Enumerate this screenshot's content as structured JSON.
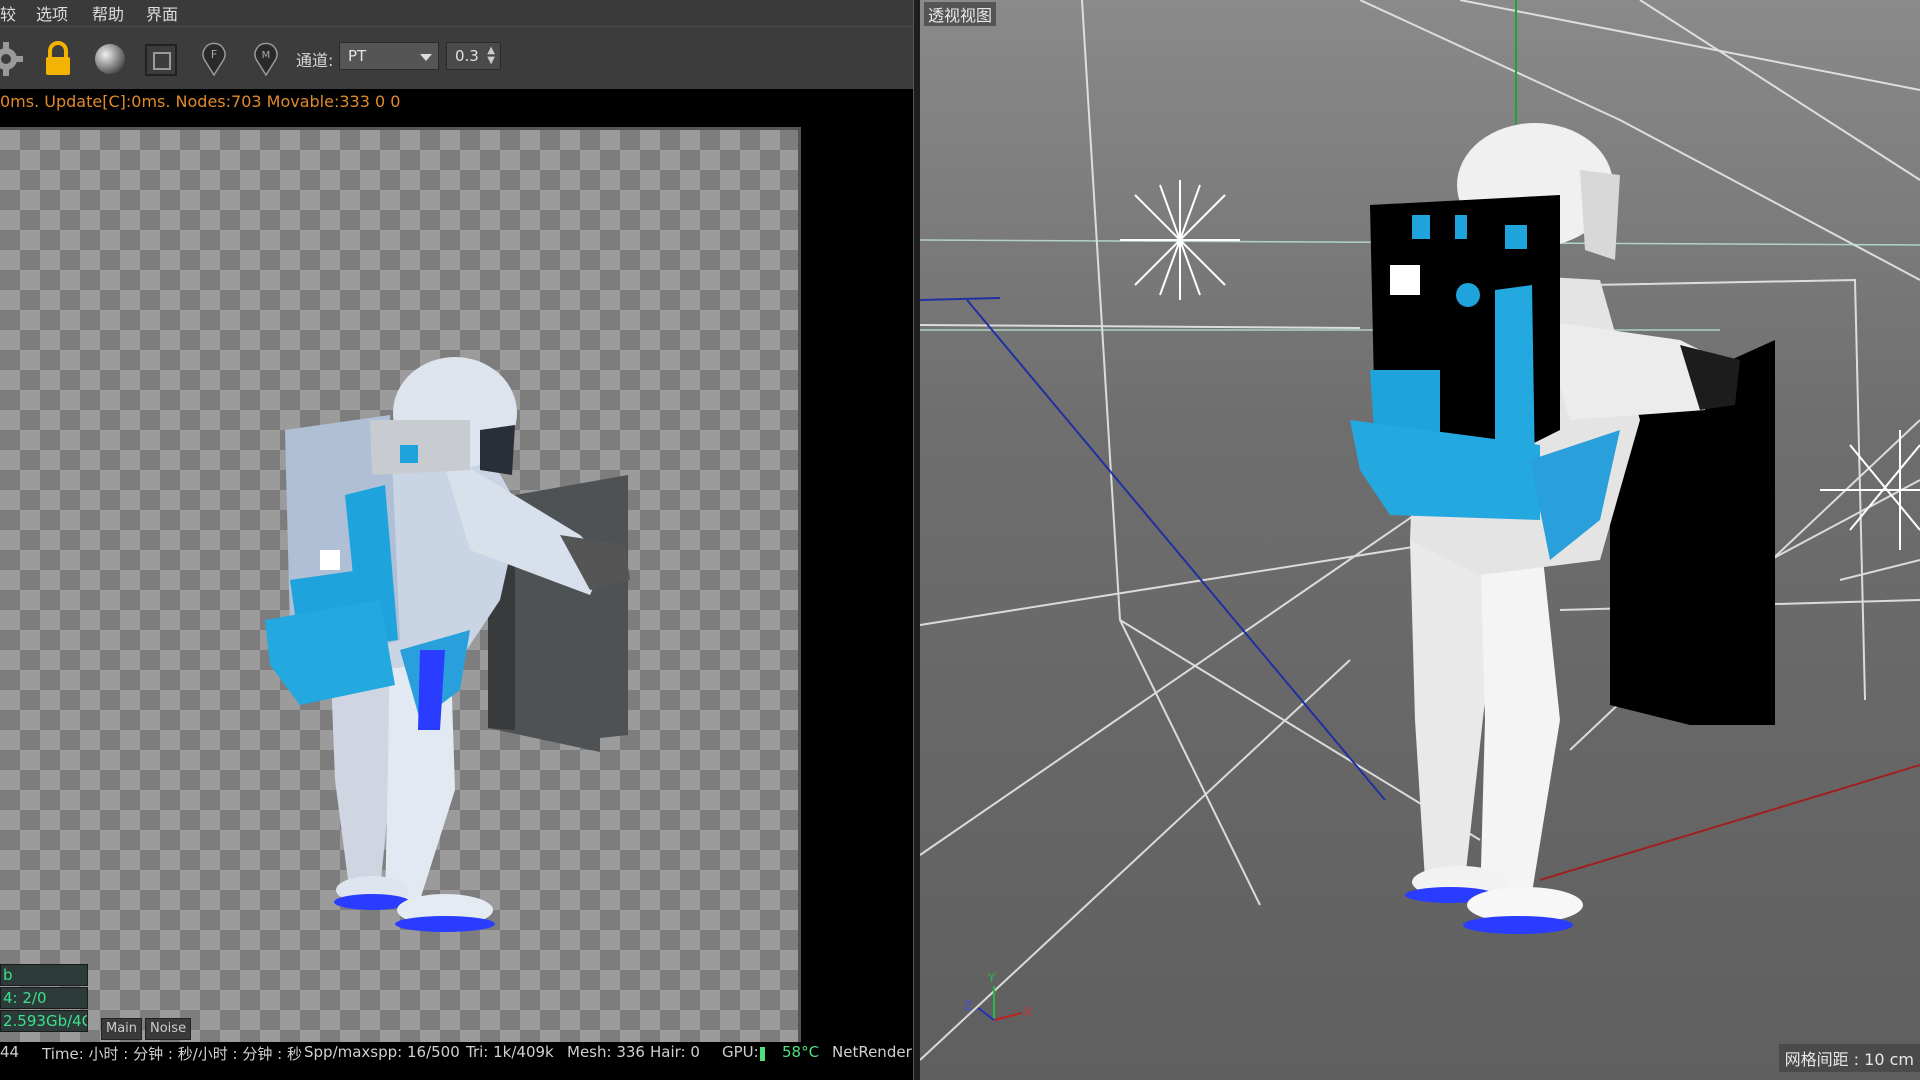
{
  "menubar": {
    "items": [
      "较",
      "选项",
      "帮助",
      "界面"
    ]
  },
  "toolbar": {
    "channel_label": "通道:",
    "channel_value": "PT",
    "spin_value": "0.3"
  },
  "status_line": "0ms. Update[C]:0ms. Nodes:703 Movable:333  0 0",
  "info_boxes": [
    "b",
    "4: 2/0",
    "2.593Gb/4Gb"
  ],
  "tabs": [
    "Main",
    "Noise"
  ],
  "bottom_bar": {
    "left_num": "44",
    "time": "Time: 小时 : 分钟 : 秒/小时 : 分钟 : 秒",
    "spp": "Spp/maxspp: 16/500",
    "tri": "Tri: 1k/409k",
    "mesh": "Mesh: 336",
    "hair": "Hair: 0",
    "gpu": "GPU:",
    "temp": "58°C",
    "netrender": "NetRender"
  },
  "viewport": {
    "title": "透视视图",
    "grid_label": "网格间距 : 10 cm",
    "axis_labels": {
      "y": "Y",
      "z": "Z",
      "x": "X"
    }
  },
  "colors": {
    "status_orange": "#e08a2a",
    "gpu_green": "#4ee07a",
    "suit_blue": "#1fa3dc",
    "boot_blue": "#2a3cff",
    "lock_yellow": "#f2b400"
  },
  "icons": [
    "gear-icon",
    "lock-icon",
    "material-sphere-icon",
    "region-icon",
    "focus-pin-icon",
    "material-pin-icon"
  ]
}
